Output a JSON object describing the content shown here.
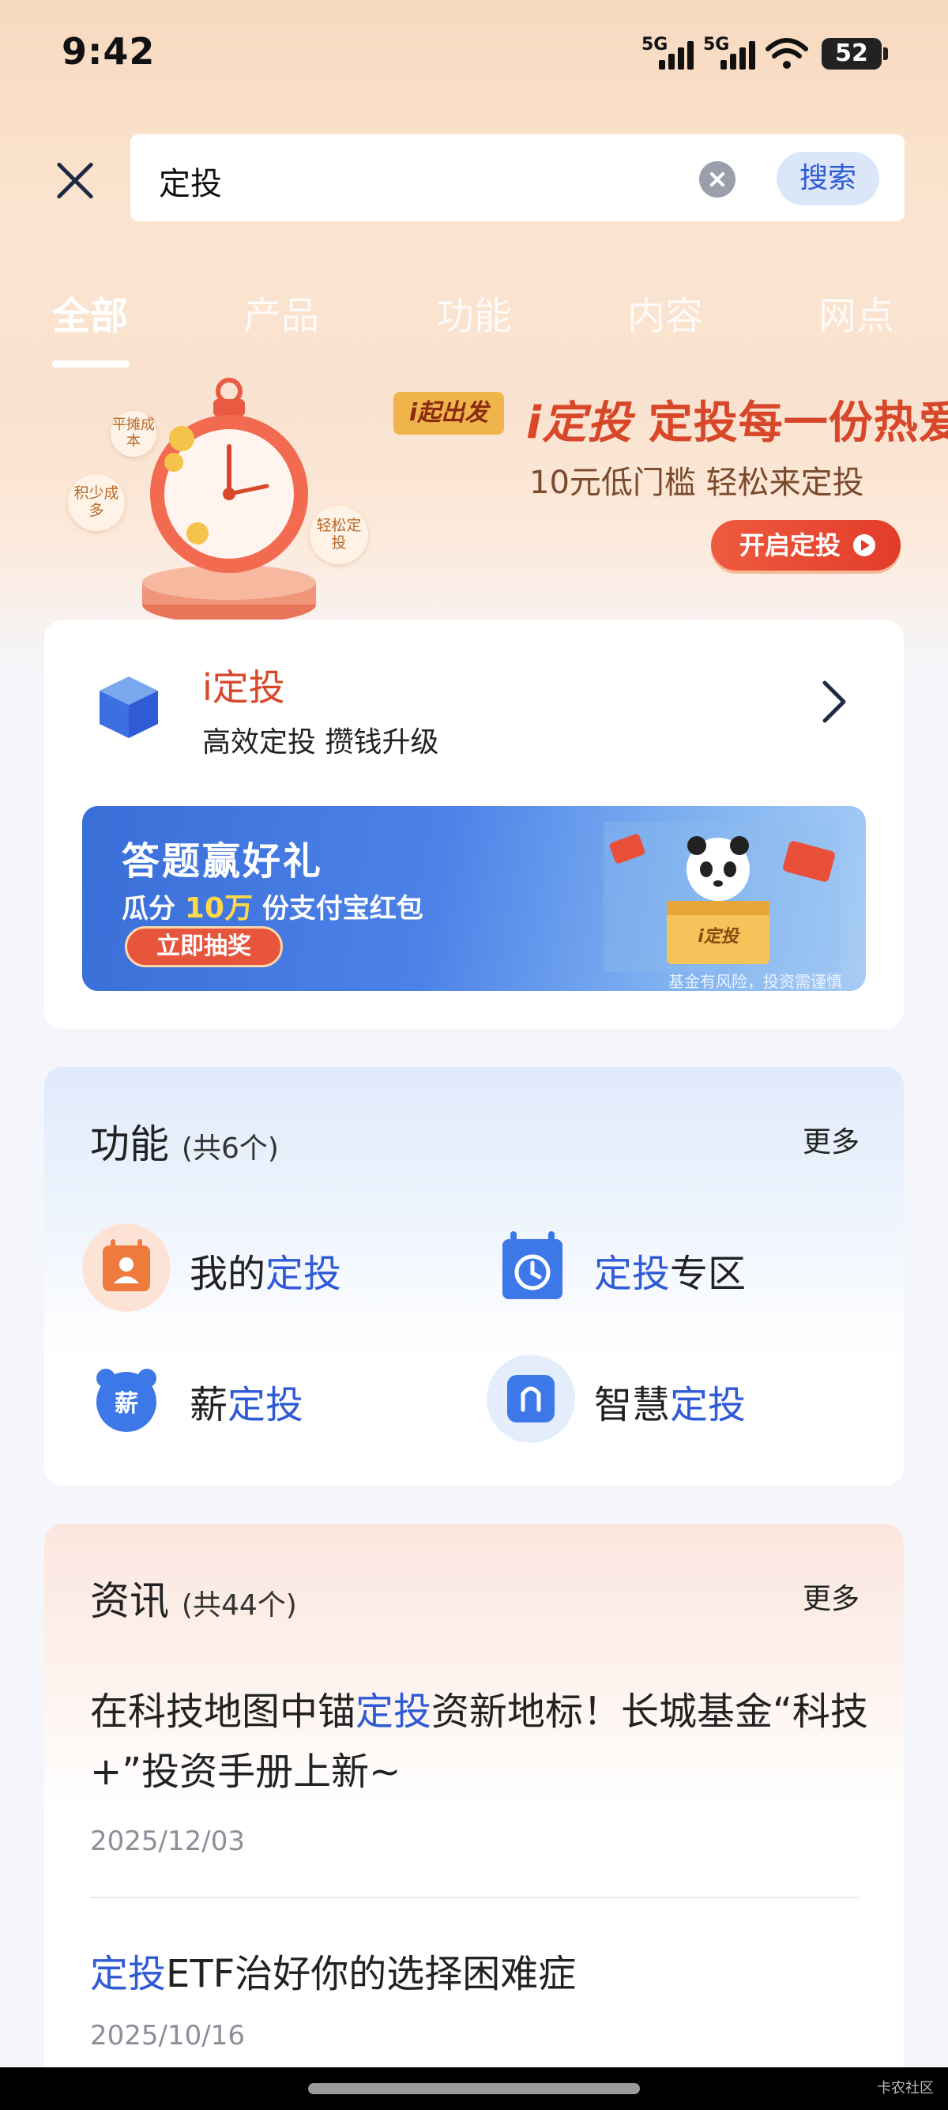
{
  "status_bar": {
    "time": "9:42",
    "signal1": "5G",
    "signal2": "5G",
    "battery": "52"
  },
  "search": {
    "query": "定投",
    "button": "搜索"
  },
  "tabs": [
    {
      "label": "全部"
    },
    {
      "label": "产品"
    },
    {
      "label": "功能"
    },
    {
      "label": "内容"
    },
    {
      "label": "网点"
    }
  ],
  "banner": {
    "tag": "i起出发",
    "title_prefix": "i定投",
    "title": "定投每一份热爱",
    "subtitle": "10元低门槛 轻松来定投",
    "button": "开启定投",
    "badges": [
      "平摊成本",
      "积少成多",
      "轻松定投"
    ]
  },
  "product": {
    "title": "i定投",
    "subtitle": "高效定投 攒钱升级",
    "promo": {
      "title": "答题赢好礼",
      "sub_prefix": "瓜分",
      "sub_highlight": "10万",
      "sub_suffix": "份支付宝红包",
      "button": "立即抽奖",
      "note": "基金有风险，投资需谨慎",
      "art_label": "i定投"
    }
  },
  "functions": {
    "title": "功能",
    "count": "(共6个)",
    "more": "更多",
    "items": [
      {
        "pre": "我的",
        "hl": "定投",
        "post": ""
      },
      {
        "pre": "",
        "hl": "定投",
        "post": "专区"
      },
      {
        "pre": "薪",
        "hl": "定投",
        "post": "",
        "icon_text": "薪"
      },
      {
        "pre": "智慧",
        "hl": "定投",
        "post": ""
      }
    ]
  },
  "news": {
    "title": "资讯",
    "count": "(共44个)",
    "more": "更多",
    "items": [
      {
        "pre": "在科技地图中锚",
        "hl": "定投",
        "post": "资新地标！长城基金“科技+”投资手册上新~",
        "date": "2025/12/03"
      },
      {
        "pre": "",
        "hl": "定投",
        "post": "ETF治好你的选择困难症",
        "date": "2025/10/16"
      }
    ]
  },
  "watermark": "卡农社区",
  "colors": {
    "accent_blue": "#2f5bd6",
    "accent_red": "#d8472a"
  }
}
